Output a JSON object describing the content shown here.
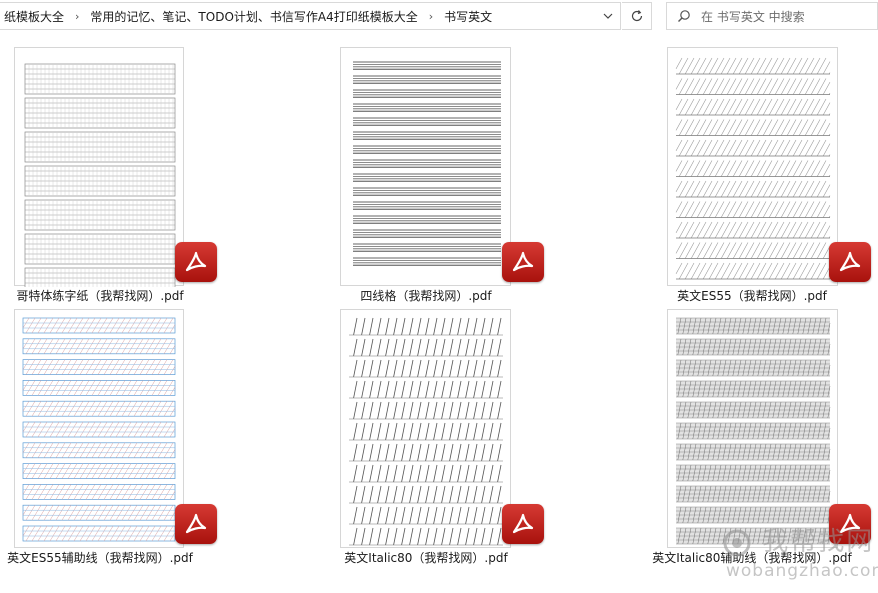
{
  "breadcrumb": {
    "items": [
      "纸模板大全",
      "常用的记忆、笔记、TODO计划、书信写作A4打印纸模板大全",
      "书写英文"
    ]
  },
  "search": {
    "placeholder": "在 书写英文 中搜索"
  },
  "files": [
    {
      "name": "哥特体练字纸（我帮找网）.pdf",
      "pattern": "gothic"
    },
    {
      "name": "四线格（我帮找网）.pdf",
      "pattern": "fourline"
    },
    {
      "name": "英文ES55（我帮找网）.pdf",
      "pattern": "es55"
    },
    {
      "name": "英文ES55辅助线（我帮找网）.pdf",
      "pattern": "es55aux"
    },
    {
      "name": "英文Italic80（我帮找网）.pdf",
      "pattern": "italic"
    },
    {
      "name": "英文Italic80辅助线（我帮找网）.pdf",
      "pattern": "italicaux"
    }
  ],
  "watermark": {
    "logo": "我帮找网",
    "url": "wobangzhao.com"
  },
  "colors": {
    "pdf_red": "#c4211b",
    "aux_blue": "#5b9bd5"
  }
}
